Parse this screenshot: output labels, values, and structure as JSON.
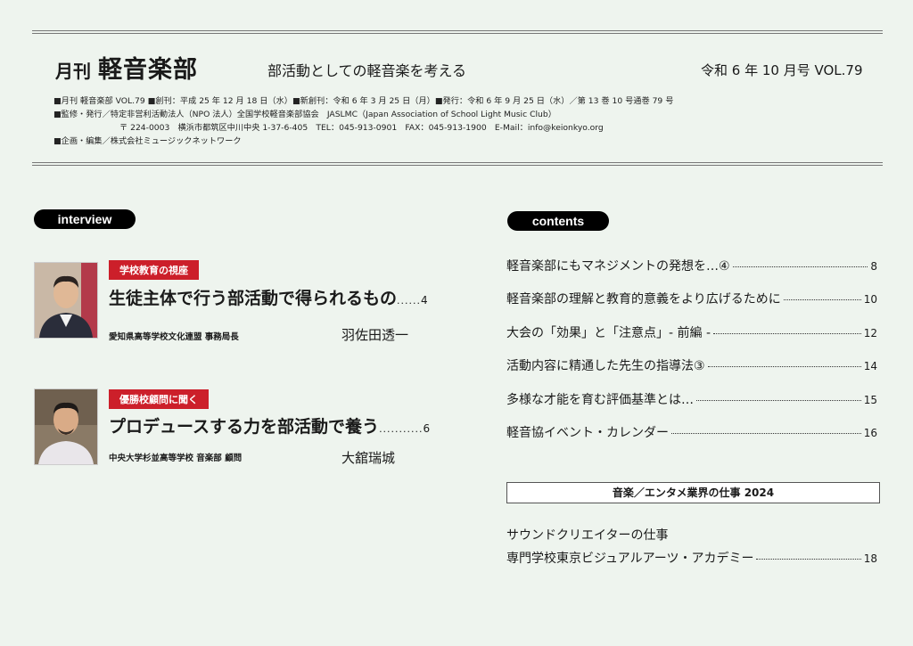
{
  "header": {
    "mag_prefix": "月刊",
    "mag_name": "軽音楽部",
    "tagline": "部活動としての軽音楽を考える",
    "issue": "令和 6 年 10 月号 VOL.79",
    "info_lines": [
      "■月刊 軽音楽部 VOL.79 ■創刊：平成 25 年 12 月 18 日（水）■新創刊：令和 6 年 3 月 25 日（月）■発行：令和 6 年 9 月 25 日（水）／第 13 巻 10 号通巻 79 号",
      "■監修・発行／特定非営利活動法人（NPO 法人）全国学校軽音楽部協会　JASLMC（Japan Association of School Light Music Club）",
      "〒 224-0003　横浜市都筑区中川中央 1-37-6-405　TEL：045-913-0901　FAX：045-913-1900　E-Mail：info@keionkyo.org",
      "■企画・編集／株式会社ミュージックネットワーク"
    ]
  },
  "interview": {
    "label": "interview",
    "items": [
      {
        "badge": "学校教育の視座",
        "title": "生徒主体で行う部活動で得られるもの",
        "dots": "......",
        "page": "4",
        "affiliation": "愛知県高等学校文化連盟 事務局長",
        "person": "羽佐田透一"
      },
      {
        "badge": "優勝校顧問に聞く",
        "title": "プロデュースする力を部活動で養う",
        "dots": "...........",
        "page": "6",
        "affiliation": "中央大学杉並高等学校 音楽部 顧問",
        "person": "大舘瑞城"
      }
    ]
  },
  "contents": {
    "label": "contents",
    "items": [
      {
        "title": "軽音楽部にもマネジメントの発想を…④",
        "page": "8"
      },
      {
        "title": "軽音楽部の理解と教育的意義をより広げるために",
        "page": "10"
      },
      {
        "title": "大会の「効果」と「注意点」- 前編 -",
        "page": "12"
      },
      {
        "title": "活動内容に精通した先生の指導法③",
        "page": "14"
      },
      {
        "title": "多様な才能を育む評価基準とは…",
        "page": "15"
      },
      {
        "title": "軽音協イベント・カレンダー",
        "page": "16"
      }
    ],
    "special": {
      "heading": "音楽／エンタメ業界の仕事 2024",
      "line1": "サウンドクリエイターの仕事",
      "line2": "専門学校東京ビジュアルアーツ・アカデミー",
      "page": "18"
    }
  },
  "colors": {
    "background": "#eef4ee",
    "badge_red": "#cc1f2a",
    "pill_black": "#000000"
  }
}
